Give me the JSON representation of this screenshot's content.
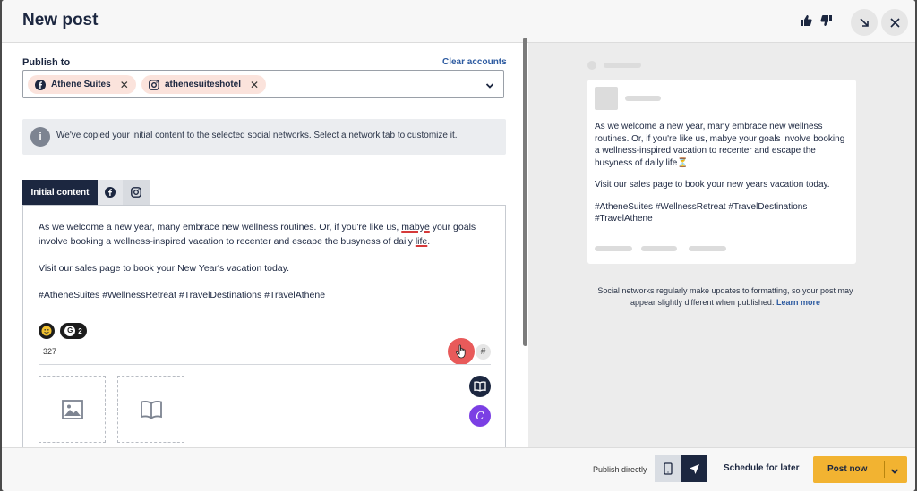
{
  "header": {
    "title": "New post"
  },
  "publish": {
    "label": "Publish to",
    "clear_label": "Clear accounts",
    "accounts": [
      {
        "name": "Athene Suites",
        "network": "facebook"
      },
      {
        "name": "athenesuiteshotel",
        "network": "instagram"
      }
    ]
  },
  "info_banner": {
    "icon": "info-icon",
    "text": "We've copied your initial content to the selected social networks. Select a network tab to customize it."
  },
  "tabs": {
    "initial_label": "Initial content",
    "network_tabs": [
      "facebook-icon",
      "instagram-icon"
    ]
  },
  "editor": {
    "line1a": "As we welcome a new year, many embrace new wellness routines. Or, if you're like us,",
    "line1_spell": "mabye",
    "line1b": "your  goals involve booking a wellness-inspired vacation to recenter and escape the busyness of daily",
    "line1_spell2": "life",
    "line1c": ".",
    "paragraph2": "Visit our sales page to book your New Year's vacation today.",
    "hashtags": "#AtheneSuites #WellnessRetreat #TravelDestinations #TravelAthene",
    "grammarly_count": "2",
    "char_count": "327",
    "hash_button": "#"
  },
  "preview": {
    "para1": "As we welcome a new year, many embrace new wellness routines. Or, if you're like us, mabye your goals involve booking a wellness-inspired vacation to recenter and escape the busyness of daily life⏳.",
    "para2": "Visit our sales page to book your new years vacation today.",
    "para3": "#AtheneSuites #WellnessRetreat #TravelDestinations #TravelAthene",
    "note": "Social networks regularly make updates to formatting, so your post may appear slightly different when published.",
    "learn_more": "Learn more"
  },
  "footer": {
    "publish_directly": "Publish directly",
    "schedule_label": "Schedule for later",
    "post_now_label": "Post now"
  },
  "colors": {
    "navy": "#1c2740",
    "accent_yellow": "#f2b331",
    "link_blue": "#2c5aa0",
    "chip_bg": "#fbe3dc",
    "ai_red": "#e85a5a",
    "canva_purple": "#7b3fe4"
  }
}
